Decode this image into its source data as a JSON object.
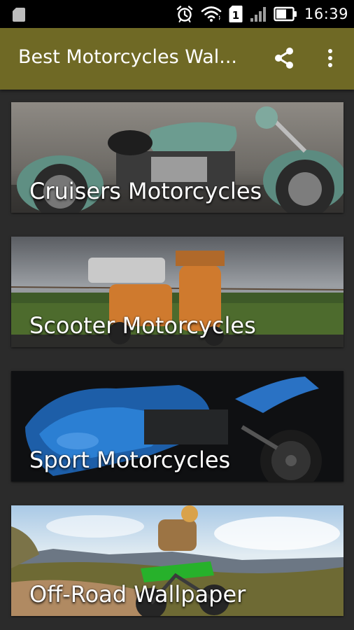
{
  "status_bar": {
    "time": "16:39",
    "icons": [
      "sd-card-icon",
      "alarm-icon",
      "wifi-icon",
      "sim-1-icon",
      "signal-icon",
      "battery-icon"
    ],
    "sim_label": "1"
  },
  "app_bar": {
    "title": "Best Motorcycles Wal...",
    "background": "#6f6925",
    "actions": [
      "share-icon",
      "more-vert-icon"
    ]
  },
  "categories": [
    {
      "label": "Cruisers Motorcycles"
    },
    {
      "label": "Scooter Motorcycles"
    },
    {
      "label": "Sport Motorcycles"
    },
    {
      "label": "Off-Road Wallpaper"
    }
  ],
  "colors": {
    "page_background": "#2b2b2b",
    "status_bar": "#000000",
    "text": "#ffffff"
  }
}
